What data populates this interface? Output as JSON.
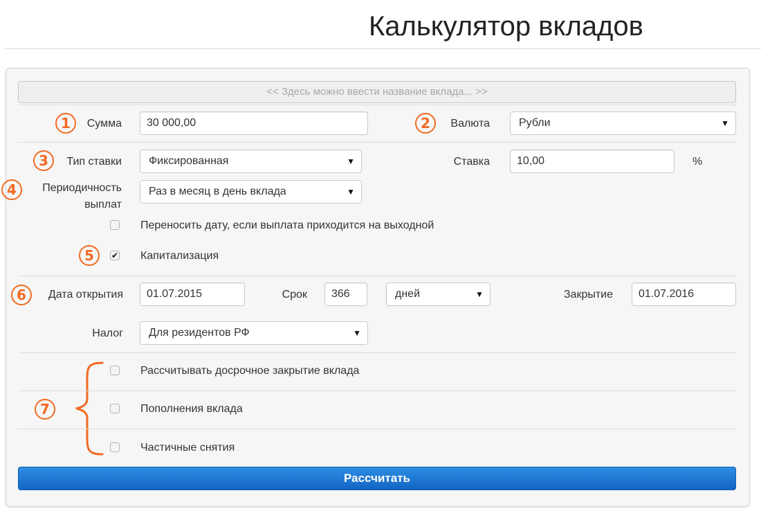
{
  "page": {
    "title": "Калькулятор вкладов"
  },
  "form": {
    "deposit_name_placeholder": "<< Здесь можно ввести название вклада... >>",
    "amount": {
      "label": "Сумма",
      "value": "30 000,00"
    },
    "currency": {
      "label": "Валюта",
      "value": "Рубли"
    },
    "rate_type": {
      "label": "Тип ставки",
      "value": "Фиксированная"
    },
    "rate": {
      "label": "Ставка",
      "value": "10,00",
      "unit": "%"
    },
    "payout_period": {
      "label_line1": "Периодичность",
      "label_line2": "выплат",
      "value": "Раз в месяц в день вклада"
    },
    "move_date": {
      "label": "Переносить дату, если выплата приходится на выходной",
      "checked": false
    },
    "capitalization": {
      "label": "Капитализация",
      "checked": true,
      "check_glyph": "✔"
    },
    "open_date": {
      "label": "Дата открытия",
      "value": "01.07.2015"
    },
    "term": {
      "label": "Срок",
      "value": "366",
      "unit_value": "дней"
    },
    "close_date": {
      "label": "Закрытие",
      "value": "01.07.2016"
    },
    "tax": {
      "label": "Налог",
      "value": "Для резидентов РФ"
    },
    "early_close": {
      "label": "Рассчитывать досрочное закрытие вклада",
      "checked": false
    },
    "replenishment": {
      "label": "Пополнения вклада",
      "checked": false
    },
    "partial_withdrawal": {
      "label": "Частичные снятия",
      "checked": false
    },
    "calculate_label": "Рассчитать"
  },
  "annotations": {
    "m1": "1",
    "m2": "2",
    "m3": "3",
    "m4": "4",
    "m5": "5",
    "m6": "6",
    "m7": "7"
  },
  "icons": {
    "dropdown": "▼"
  },
  "colors": {
    "annotation": "#f26a21",
    "button": "#1a73d0",
    "panel_bg": "#f6f6f6"
  }
}
